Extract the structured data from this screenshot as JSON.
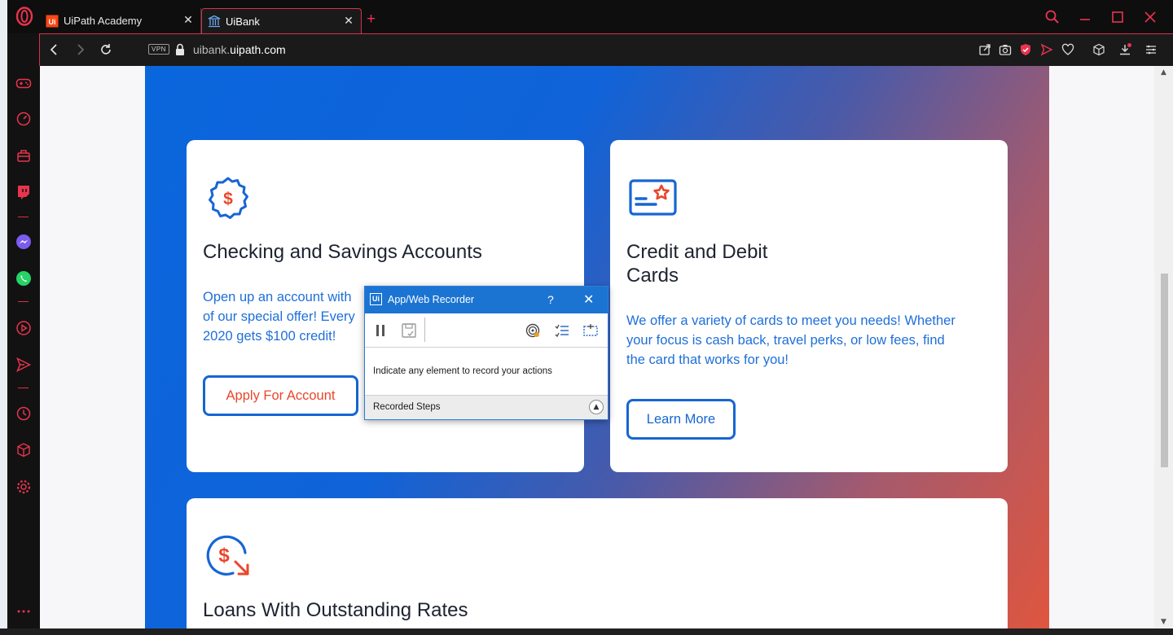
{
  "browser": {
    "tabs": [
      {
        "label": "UiPath Academy",
        "favicon": "uipath-logo-icon",
        "active": false
      },
      {
        "label": "UiBank",
        "favicon": "bank-icon",
        "active": true
      }
    ],
    "new_tab": "+",
    "url_prefix": "uibank.",
    "url_domain": "uipath.com",
    "vpn_label": "VPN",
    "accent": "#d8304a"
  },
  "cards": {
    "checking": {
      "title": "Checking and Savings Accounts",
      "text_line1": "Open up an account with",
      "text_line2": "of our special offer! Every",
      "text_line3": "2020 gets $100 credit!",
      "button": "Apply For Account"
    },
    "credit": {
      "title_line1": "Credit and Debit",
      "title_line2": "Cards",
      "text_line1": "We offer a variety of cards to meet you needs! Whether",
      "text_line2": "your focus is cash back, travel perks, or low fees, find",
      "text_line3": "the card that works for you!",
      "button": "Learn More"
    },
    "loans": {
      "title": "Loans With Outstanding Rates"
    }
  },
  "recorder": {
    "logo": "Ui",
    "title": "App/Web Recorder",
    "help": "?",
    "close": "✕",
    "message": "Indicate any element to record your actions",
    "steps_label": "Recorded Steps"
  },
  "colors": {
    "brand_blue": "#1666d3",
    "button_orange_text": "#e9462b",
    "icon_orange": "#e9462b"
  }
}
